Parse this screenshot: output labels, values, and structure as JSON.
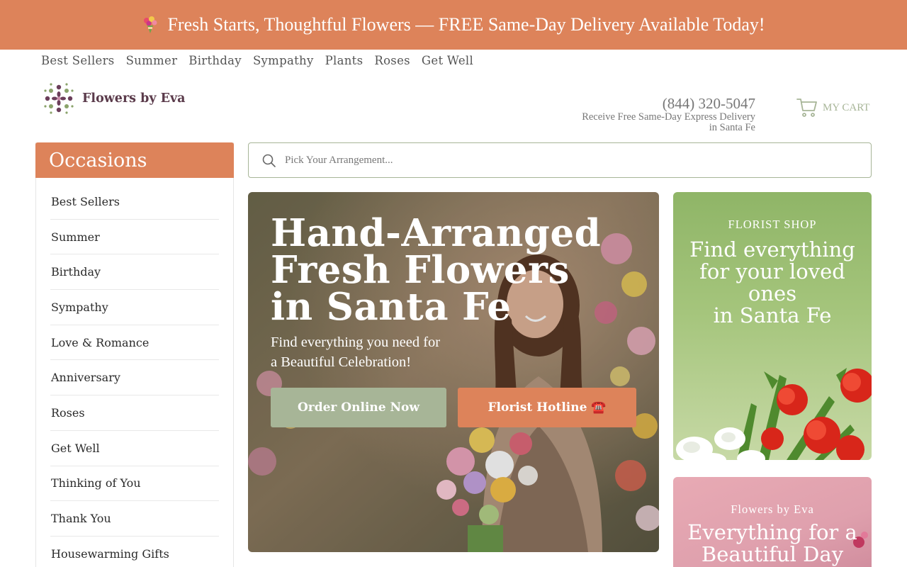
{
  "promo": {
    "text": "Fresh Starts, Thoughtful Flowers — FREE Same-Day Delivery Available Today!",
    "icon": "bouquet-icon"
  },
  "topnav": {
    "items": [
      "Best Sellers",
      "Summer",
      "Birthday",
      "Sympathy",
      "Plants",
      "Roses",
      "Get Well"
    ]
  },
  "header": {
    "logo_text": "Flowers by Eva",
    "phone": "(844) 320-5047",
    "tagline_line1": "Receive Free Same-Day Express Delivery",
    "tagline_line2": "in Santa Fe",
    "cart_label": "MY CART"
  },
  "sidebar": {
    "title": "Occasions",
    "items": [
      "Best Sellers",
      "Summer",
      "Birthday",
      "Sympathy",
      "Love & Romance",
      "Anniversary",
      "Roses",
      "Get Well",
      "Thinking of You",
      "Thank You",
      "Housewarming Gifts"
    ]
  },
  "search": {
    "placeholder": "Pick Your Arrangement..."
  },
  "hero": {
    "title_line1": "Hand-Arranged",
    "title_line2": "Fresh Flowers",
    "title_line3": "in Santa Fe",
    "sub_line1": "Find everything you need for",
    "sub_line2": "a Beautiful Celebration!",
    "order_button": "Order Online Now",
    "hotline_button": "Florist Hotline ☎️"
  },
  "cards": [
    {
      "eyebrow": "FLORIST SHOP",
      "heading_line1": "Find everything",
      "heading_line2": "for your loved",
      "heading_line3": "ones",
      "heading_line4": "in Santa Fe"
    },
    {
      "eyebrow": "Flowers by Eva",
      "heading_line1": "Everything for a",
      "heading_line2": "Beautiful Day"
    }
  ],
  "colors": {
    "accent": "#dd835a",
    "sage": "#a7b597",
    "logo_text": "#5a3a4a"
  }
}
